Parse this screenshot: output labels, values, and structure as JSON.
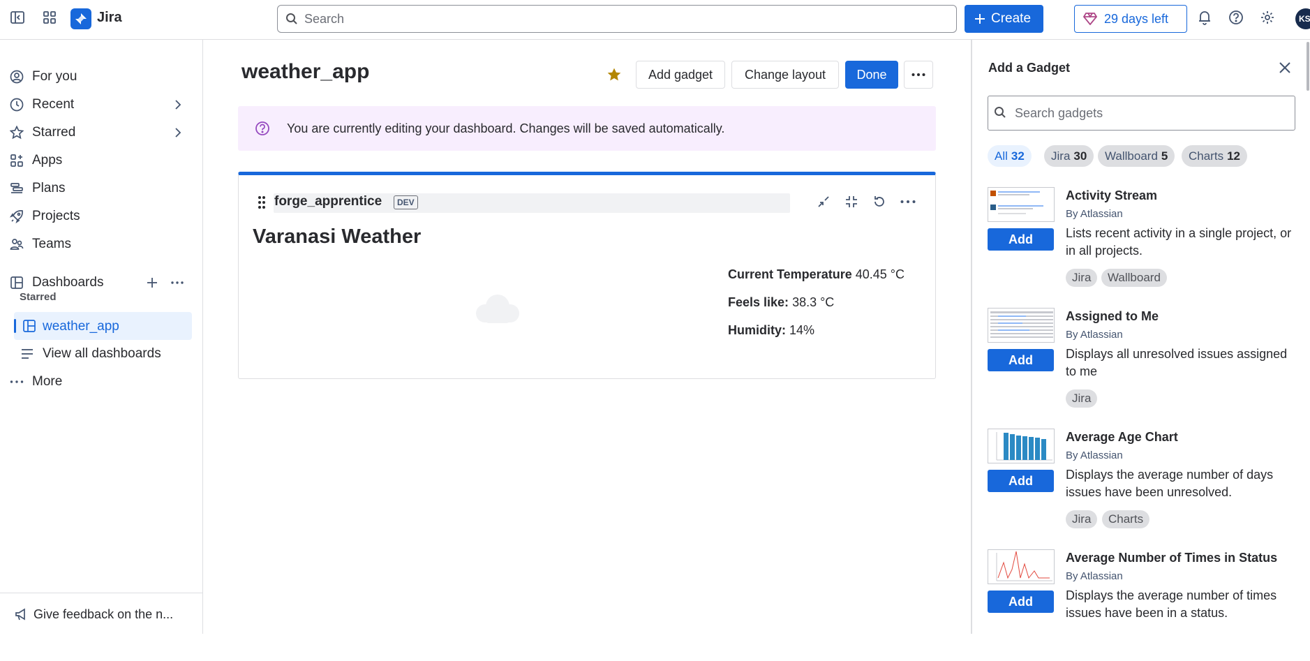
{
  "topbar": {
    "brand": "Jira",
    "search_placeholder": "Search",
    "create_label": "Create",
    "trial_label": "29 days left",
    "avatar_initials": "KS",
    "accent": "#1868db"
  },
  "sidebar": {
    "items": [
      {
        "label": "For you",
        "icon": "person-icon"
      },
      {
        "label": "Recent",
        "icon": "clock-icon"
      },
      {
        "label": "Starred",
        "icon": "star-icon"
      },
      {
        "label": "Apps",
        "icon": "apps-icon"
      },
      {
        "label": "Plans",
        "icon": "plans-icon"
      },
      {
        "label": "Projects",
        "icon": "rocket-icon"
      },
      {
        "label": "Teams",
        "icon": "people-icon"
      }
    ],
    "dashboards_label": "Dashboards",
    "starred_header": "Starred",
    "selected_dashboard": "weather_app",
    "view_all_label": "View all dashboards",
    "more_label": "More",
    "feedback_label": "Give feedback on the n..."
  },
  "main": {
    "title": "weather_app",
    "add_gadget_label": "Add gadget",
    "change_layout_label": "Change layout",
    "done_label": "Done",
    "banner_text": "You are currently editing your dashboard. Changes will be saved automatically.",
    "gadget": {
      "name": "forge_apprentice",
      "badge": "DEV",
      "heading": "Varanasi Weather",
      "temp_label": "Current Temperature",
      "temp_value": "40.45 °C",
      "feels_label": "Feels like:",
      "feels_value": "38.3 °C",
      "humidity_label": "Humidity:",
      "humidity_value": "14%"
    }
  },
  "panel": {
    "title": "Add a Gadget",
    "search_placeholder": "Search gadgets",
    "filters": [
      {
        "label": "All",
        "count": "32",
        "active": true
      },
      {
        "label": "Jira",
        "count": "30"
      },
      {
        "label": "Wallboard",
        "count": "5"
      },
      {
        "label": "Charts",
        "count": "12"
      }
    ],
    "add_label": "Add",
    "gadgets": [
      {
        "title": "Activity Stream",
        "by": "By Atlassian",
        "desc": "Lists recent activity in a single project, or in all projects.",
        "tags": [
          "Jira",
          "Wallboard"
        ]
      },
      {
        "title": "Assigned to Me",
        "by": "By Atlassian",
        "desc": "Displays all unresolved issues assigned to me",
        "tags": [
          "Jira"
        ]
      },
      {
        "title": "Average Age Chart",
        "by": "By Atlassian",
        "desc": "Displays the average number of days issues have been unresolved.",
        "tags": [
          "Jira",
          "Charts"
        ]
      },
      {
        "title": "Average Number of Times in Status",
        "by": "By Atlassian",
        "desc": "Displays the average number of times issues have been in a status.",
        "tags": []
      }
    ]
  }
}
